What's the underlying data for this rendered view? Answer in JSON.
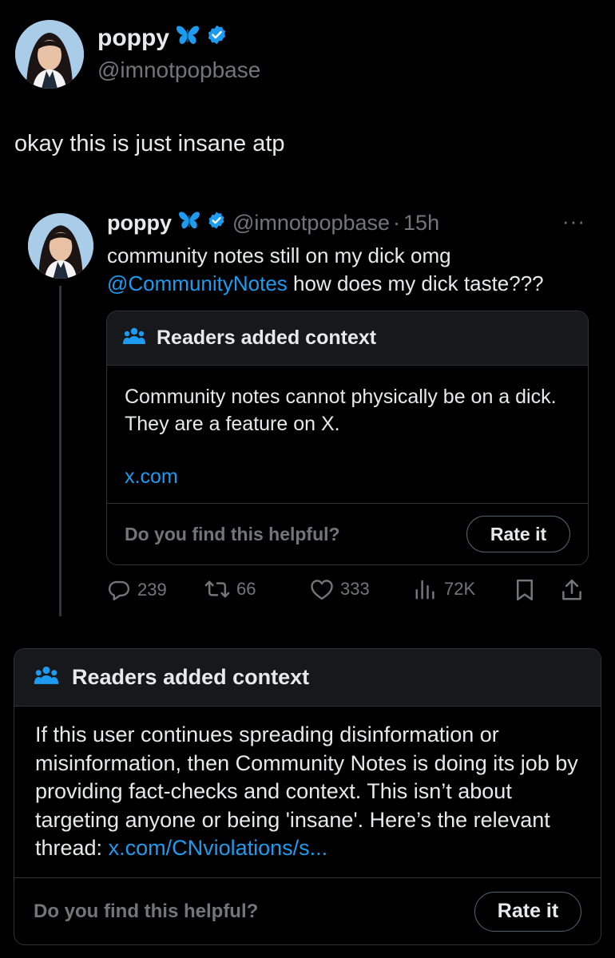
{
  "author": {
    "name": "poppy",
    "handle": "@imnotpopbase",
    "emoji": "butterfly",
    "verified": true
  },
  "post": {
    "text": "okay this is just insane atp"
  },
  "quoted": {
    "name": "poppy",
    "handle": "@imnotpopbase",
    "dot": "·",
    "time": "15h",
    "more": "···",
    "text_line1": "community notes still on my dick omg",
    "mention": "@CommunityNotes",
    "text_rest": " how does my dick taste???",
    "note": {
      "title": "Readers added context",
      "body": "Community notes cannot physically be on a dick. They are a feature on X.",
      "link": "x.com",
      "helpful_prompt": "Do you find this helpful?",
      "rate_label": "Rate it"
    },
    "stats": {
      "replies": "239",
      "reposts": "66",
      "likes": "333",
      "views": "72K"
    }
  },
  "note": {
    "title": "Readers added context",
    "body": "If this user continues spreading disinformation or misinformation, then Community Notes is doing its job by providing fact-checks and context. This isn’t about targeting anyone or being 'insane'. Here’s the relevant thread: ",
    "link": "x.com/CNviolations/s...",
    "helpful_prompt": "Do you find this helpful?",
    "rate_label": "Rate it"
  },
  "colors": {
    "background": "#000000",
    "text": "#e7e9ea",
    "muted": "#71767b",
    "accent": "#1d9bf0",
    "border": "#2f3336",
    "note_header": "#16181c"
  }
}
